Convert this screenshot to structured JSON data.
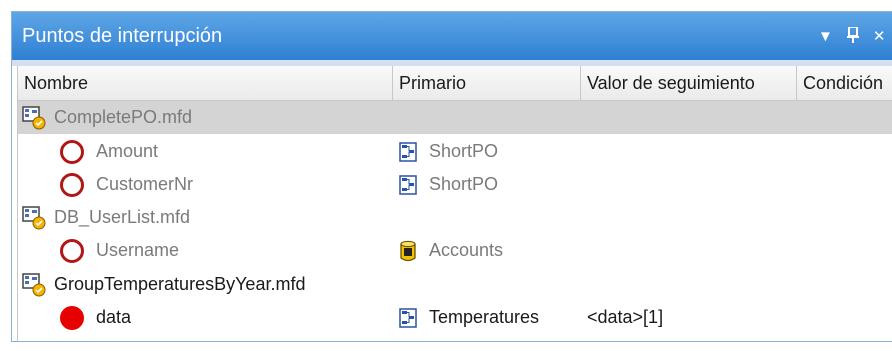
{
  "panel": {
    "title": "Puntos de interrupción",
    "title_icons": [
      "dropdown-arrow-icon",
      "pin-icon",
      "close-icon"
    ]
  },
  "columns": [
    "Nombre",
    "Primario",
    "Valor de seguimiento",
    "Condición"
  ],
  "rows": [
    {
      "kind": "file",
      "name": "CompletePO.mfd",
      "primary": "",
      "watch": "",
      "selected": true,
      "muted": true
    },
    {
      "kind": "breakpoint",
      "name": "Amount",
      "primary": "ShortPO",
      "primary_icon": "structure-icon",
      "watch": "",
      "muted": true
    },
    {
      "kind": "breakpoint",
      "name": "CustomerNr",
      "primary": "ShortPO",
      "primary_icon": "structure-icon",
      "watch": "",
      "muted": true
    },
    {
      "kind": "file",
      "name": "DB_UserList.mfd",
      "primary": "",
      "watch": "",
      "muted": true
    },
    {
      "kind": "breakpoint",
      "name": "Username",
      "primary": "Accounts",
      "primary_icon": "database-icon",
      "watch": "",
      "muted": true
    },
    {
      "kind": "file",
      "name": "GroupTemperaturesByYear.mfd",
      "primary": "",
      "watch": "",
      "muted": false
    },
    {
      "kind": "breakpoint-active",
      "name": "data",
      "primary": "Temperatures",
      "primary_icon": "structure-icon",
      "watch": "<data>[1]",
      "muted": false
    }
  ],
  "colors": {
    "titlebar": "#2f7fd3",
    "breakpoint": "#b01818",
    "breakpoint_active": "#e60000",
    "selected_row": "#d4d4d4"
  }
}
